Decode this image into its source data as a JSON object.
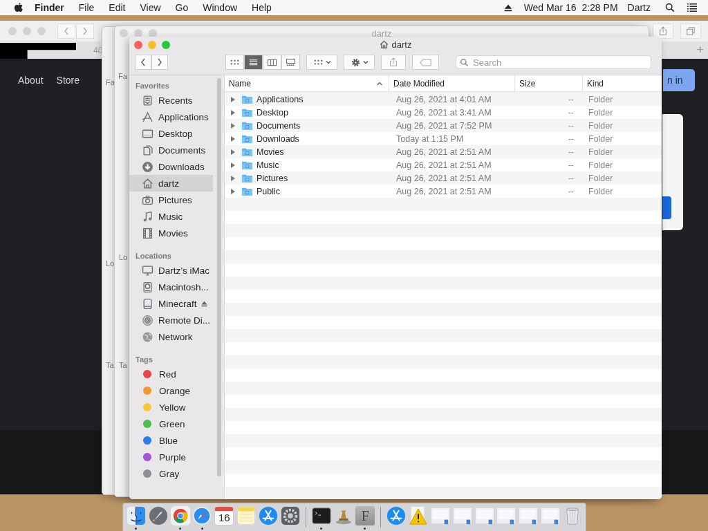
{
  "menu_bar": {
    "app": "Finder",
    "menus": [
      "File",
      "Edit",
      "View",
      "Go",
      "Window",
      "Help"
    ],
    "clock": "Wed Mar 16  2:28 PM",
    "user": "Dartz"
  },
  "browser": {
    "tab_text": "40",
    "new_tab": "+",
    "nav_links": [
      "About",
      "Store"
    ],
    "sign_in": "n in"
  },
  "background_windows": [
    {
      "sidebar": [
        "Fa",
        "Lo",
        "Ta"
      ]
    },
    {
      "title": "dartz",
      "sidebar": [
        "Fa",
        "Lo",
        "Ta"
      ]
    }
  ],
  "finder": {
    "title": "dartz",
    "view_modes": [
      {
        "selected": false
      },
      {
        "selected": true
      },
      {
        "selected": false
      },
      {
        "selected": false
      }
    ],
    "search": {
      "placeholder": "Search"
    },
    "sidebar": [
      {
        "heading": "Favorites",
        "items": [
          {
            "label": "Recents",
            "selected": false
          },
          {
            "label": "Applications",
            "selected": false
          },
          {
            "label": "Desktop",
            "selected": false
          },
          {
            "label": "Documents",
            "selected": false
          },
          {
            "label": "Downloads",
            "selected": false
          },
          {
            "label": "dartz",
            "selected": true
          },
          {
            "label": "Pictures",
            "selected": false
          },
          {
            "label": "Music",
            "selected": false
          },
          {
            "label": "Movies",
            "selected": false
          }
        ]
      },
      {
        "heading": "Locations",
        "items": [
          {
            "label": "Dartz’s iMac",
            "selected": false,
            "ejectable": false
          },
          {
            "label": "Macintosh...",
            "selected": false,
            "ejectable": false
          },
          {
            "label": "Minecraft",
            "selected": false,
            "ejectable": true
          },
          {
            "label": "Remote Di...",
            "selected": false,
            "ejectable": false
          },
          {
            "label": "Network",
            "selected": false,
            "ejectable": false
          }
        ]
      },
      {
        "heading": "Tags",
        "items": [
          {
            "label": "Red",
            "selected": false,
            "color": "#e9424b"
          },
          {
            "label": "Orange",
            "selected": false,
            "color": "#f29a32"
          },
          {
            "label": "Yellow",
            "selected": false,
            "color": "#f5c933"
          },
          {
            "label": "Green",
            "selected": false,
            "color": "#45c048"
          },
          {
            "label": "Blue",
            "selected": false,
            "color": "#2f7bf0"
          },
          {
            "label": "Purple",
            "selected": false,
            "color": "#a256d8"
          },
          {
            "label": "Gray",
            "selected": false,
            "color": "#8e8e92"
          }
        ]
      }
    ],
    "columns": [
      {
        "label": "Name",
        "sorted": true
      },
      {
        "label": "Date Modified",
        "sorted": false
      },
      {
        "label": "Size",
        "sorted": false
      },
      {
        "label": "Kind",
        "sorted": false
      }
    ],
    "rows": [
      {
        "expanded": false,
        "cells": [
          "Applications",
          "Aug 26, 2021 at 4:01 AM",
          "--",
          "Folder"
        ]
      },
      {
        "expanded": false,
        "cells": [
          "Desktop",
          "Aug 26, 2021 at 3:41 AM",
          "--",
          "Folder"
        ]
      },
      {
        "expanded": false,
        "cells": [
          "Documents",
          "Aug 26, 2021 at 7:52 PM",
          "--",
          "Folder"
        ]
      },
      {
        "expanded": false,
        "cells": [
          "Downloads",
          "Today at 1:15 PM",
          "--",
          "Folder"
        ]
      },
      {
        "expanded": false,
        "cells": [
          "Movies",
          "Aug 26, 2021 at 2:51 AM",
          "--",
          "Folder"
        ]
      },
      {
        "expanded": false,
        "cells": [
          "Music",
          "Aug 26, 2021 at 2:51 AM",
          "--",
          "Folder"
        ]
      },
      {
        "expanded": false,
        "cells": [
          "Pictures",
          "Aug 26, 2021 at 2:51 AM",
          "--",
          "Folder"
        ]
      },
      {
        "expanded": false,
        "cells": [
          "Public",
          "Aug 26, 2021 at 2:51 AM",
          "--",
          "Folder"
        ]
      }
    ]
  },
  "dock": {
    "items": [
      {
        "kind": "finder",
        "running": true
      },
      {
        "kind": "rocket",
        "running": false
      },
      {
        "kind": "browser",
        "running": true
      },
      {
        "kind": "compass",
        "running": true
      },
      {
        "kind": "calendar",
        "running": false,
        "text": "16"
      },
      {
        "kind": "notes",
        "running": false
      },
      {
        "kind": "store",
        "running": false
      },
      {
        "kind": "gear",
        "running": false
      },
      {
        "kind": "separator"
      },
      {
        "kind": "terminal",
        "running": true
      },
      {
        "kind": "chess",
        "running": false
      },
      {
        "kind": "font",
        "running": true,
        "text": "F"
      },
      {
        "kind": "separator"
      },
      {
        "kind": "store",
        "running": false
      },
      {
        "kind": "warning",
        "running": false
      },
      {
        "kind": "document",
        "running": false
      },
      {
        "kind": "document",
        "running": false
      },
      {
        "kind": "document",
        "running": false
      },
      {
        "kind": "document",
        "running": false
      },
      {
        "kind": "document",
        "running": false
      },
      {
        "kind": "document",
        "running": false
      },
      {
        "kind": "trash",
        "running": false
      }
    ]
  }
}
